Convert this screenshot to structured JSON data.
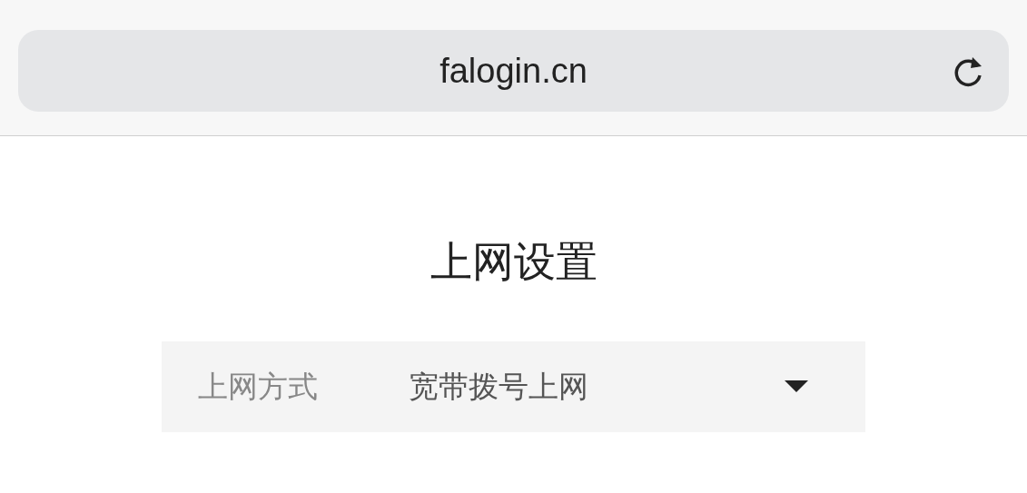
{
  "address_bar": {
    "url": "falogin.cn"
  },
  "page": {
    "title": "上网设置",
    "fields": [
      {
        "label": "上网方式",
        "value": "宽带拨号上网"
      }
    ]
  }
}
